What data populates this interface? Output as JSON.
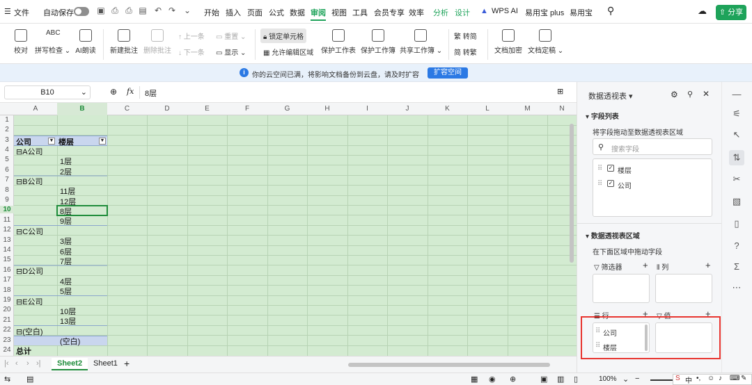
{
  "menubar": {
    "file": "文件",
    "autosave": "自动保存",
    "tabs": [
      "开始",
      "插入",
      "页面",
      "公式",
      "数据",
      "审阅",
      "视图",
      "工具",
      "会员专享",
      "效率",
      "分析",
      "设计",
      "WPS AI",
      "易用宝 plus",
      "易用宝"
    ],
    "share": "分享"
  },
  "ribbon": {
    "spellcheck": "校对",
    "spellcheck2": "拼写检查",
    "ai_read": "AI朗读",
    "new_comment": "新建批注",
    "del_comment": "删除批注",
    "prev": "上一条",
    "next": "下一条",
    "reset": "重置",
    "show": "显示",
    "lock_cell": "锁定单元格",
    "allow_edit": "允许编辑区域",
    "protect_sheet": "保护工作表",
    "protect_book": "保护工作簿",
    "share_book": "共享工作簿",
    "to_simp": "转简",
    "to_trad": "转繁",
    "encrypt": "文档加密",
    "finalize": "文档定稿"
  },
  "notice": {
    "text": "你的云空间已满，将影响文档备份到云盘，请及时扩容",
    "button": "扩容空间"
  },
  "formula_bar": {
    "cell_ref": "B10",
    "fx": "fx",
    "value": "8层"
  },
  "columns": [
    "A",
    "B",
    "C",
    "D",
    "E",
    "F",
    "G",
    "H",
    "I",
    "J",
    "K",
    "L",
    "M",
    "N"
  ],
  "rows": [
    "1",
    "2",
    "3",
    "4",
    "5",
    "6",
    "7",
    "8",
    "9",
    "10",
    "11",
    "12",
    "13",
    "14",
    "15",
    "16",
    "17",
    "18",
    "19",
    "20",
    "21",
    "22",
    "23",
    "24"
  ],
  "pivot": {
    "h_company": "公司",
    "h_floor": "楼层",
    "a": "A公司",
    "a1": "1层",
    "a2": "2层",
    "b": "B公司",
    "b1": "11层",
    "b2": "12层",
    "b3": "8层",
    "b4": "9层",
    "c": "C公司",
    "c1": "3层",
    "c2": "6层",
    "c3": "7层",
    "d": "D公司",
    "d1": "4层",
    "d2": "5层",
    "e": "E公司",
    "e1": "10层",
    "e2": "13层",
    "blank": "(空白)",
    "blank1": "(空白)",
    "total": "总计"
  },
  "sheets": {
    "s1": "Sheet2",
    "s2": "Sheet1"
  },
  "panel": {
    "title": "数据透视表",
    "field_list": "字段列表",
    "drag_hint": "将字段拖动至数据透视表区域",
    "search_placeholder": "搜索字段",
    "fields": [
      "楼层",
      "公司"
    ],
    "area_title": "数据透视表区域",
    "area_hint": "在下面区域中拖动字段",
    "filter": "筛选器",
    "column": "列",
    "row": "行",
    "value": "值",
    "row_items": [
      "公司",
      "楼层"
    ]
  },
  "status": {
    "zoom": "100%",
    "ime": "中"
  },
  "colors": {
    "accent": "#1ea35a",
    "selection": "#1e8c3a",
    "grid_bg": "#d3ebd1",
    "highlight": "#e8342f"
  }
}
